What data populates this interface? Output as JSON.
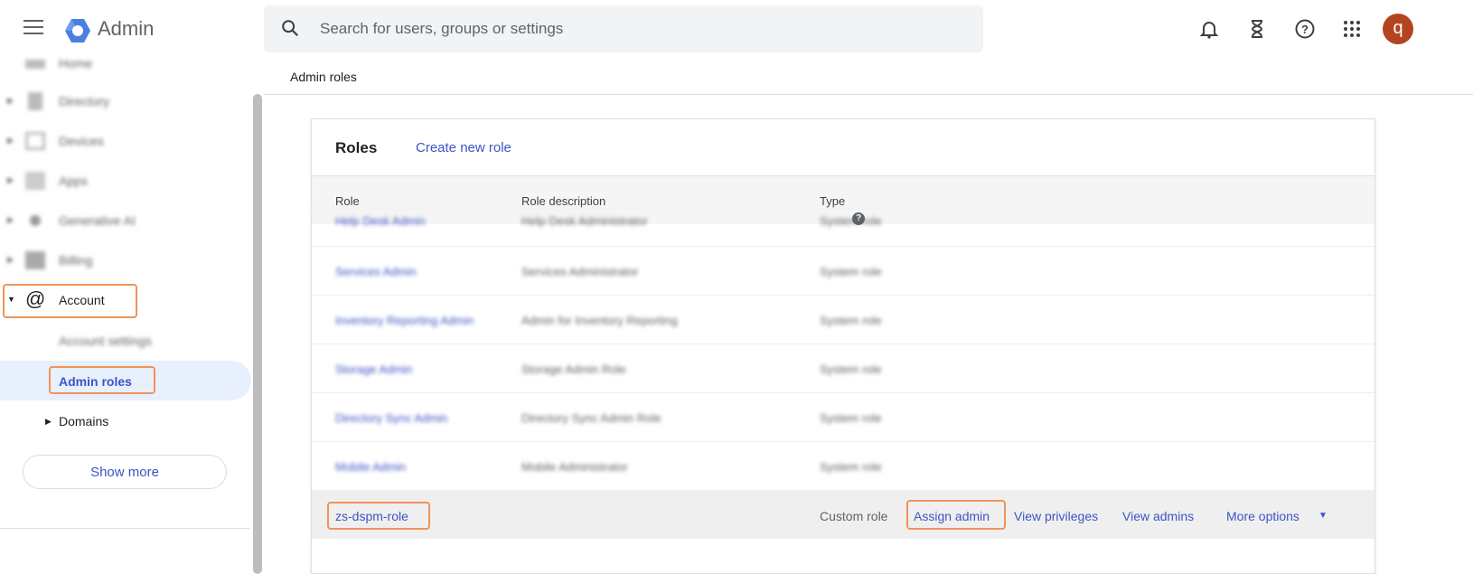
{
  "header": {
    "app_name": "Admin",
    "search_placeholder": "Search for users, groups or settings",
    "avatar_letter": "q"
  },
  "breadcrumb": "Admin roles",
  "sidebar": {
    "items": [
      {
        "label": "Home"
      },
      {
        "label": "Directory"
      },
      {
        "label": "Devices"
      },
      {
        "label": "Apps"
      },
      {
        "label": "Generative AI"
      },
      {
        "label": "Billing"
      }
    ],
    "account": "Account",
    "account_settings": "Account settings",
    "admin_roles": "Admin roles",
    "domains": "Domains",
    "show_more": "Show more"
  },
  "roles": {
    "title": "Roles",
    "create": "Create new role",
    "columns": [
      "Role",
      "Role description",
      "Type"
    ],
    "rows": [
      {
        "role": "Help Desk Admin",
        "desc": "Help Desk Administrator",
        "type": "System role"
      },
      {
        "role": "Services Admin",
        "desc": "Services Administrator",
        "type": "System role"
      },
      {
        "role": "Inventory Reporting Admin",
        "desc": "Admin for Inventory Reporting",
        "type": "System role"
      },
      {
        "role": "Storage Admin",
        "desc": "Storage Admin Role",
        "type": "System role"
      },
      {
        "role": "Directory Sync Admin",
        "desc": "Directory Sync Admin Role",
        "type": "System role"
      },
      {
        "role": "Mobile Admin",
        "desc": "Mobile Administrator",
        "type": "System role"
      }
    ],
    "selected": {
      "role": "zs-dspm-role",
      "type": "Custom role",
      "actions": [
        "Assign admin",
        "View privileges",
        "View admins",
        "More options"
      ]
    }
  }
}
